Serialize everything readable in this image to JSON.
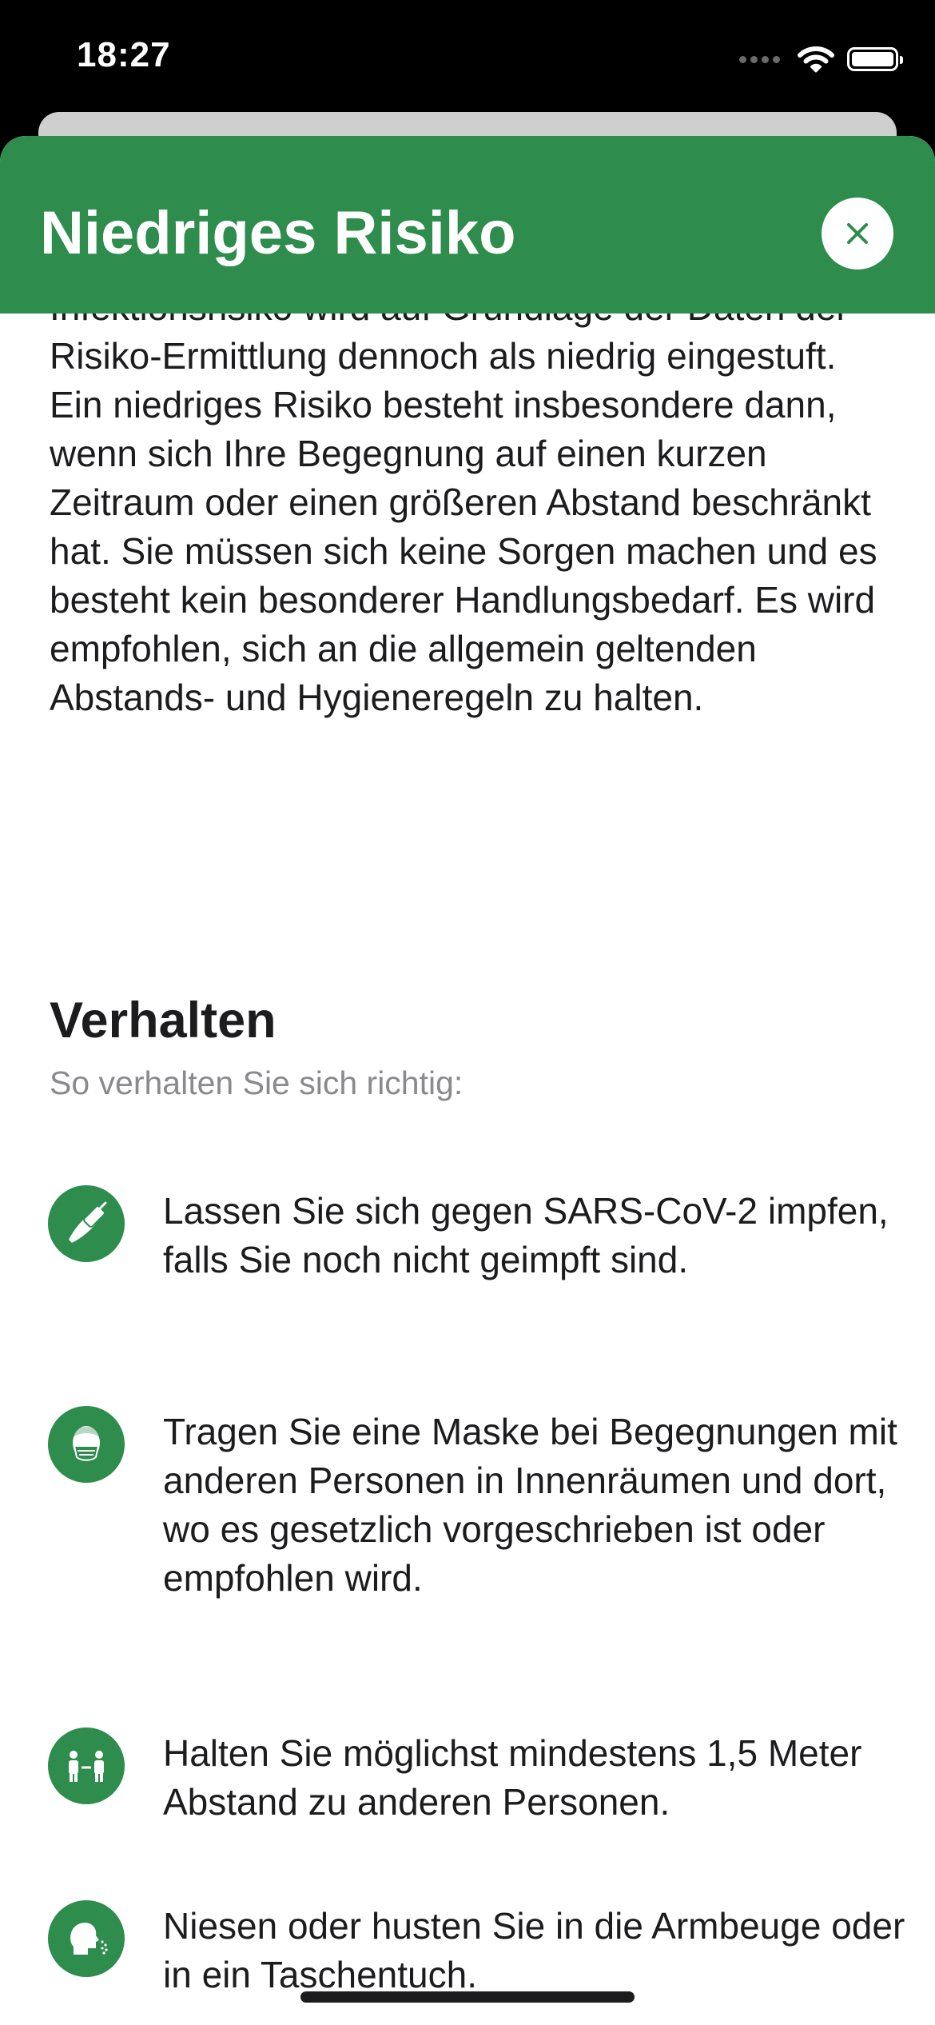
{
  "status_bar": {
    "time": "18:27"
  },
  "header": {
    "title": "Niedriges Risiko",
    "close_icon": "close-icon"
  },
  "description": "Infektionsrisiko wird auf Grundlage der Daten der Risiko-Ermittlung dennoch als niedrig eingestuft. Ein niedriges Risiko besteht insbesondere dann, wenn sich Ihre Begegnung auf einen kurzen Zeitraum oder einen größeren Abstand beschränkt hat. Sie müssen sich keine Sorgen machen und es besteht kein besonderer Handlungsbedarf. Es wird empfohlen, sich an die allgemein geltenden Abstands- und Hygieneregeln zu halten.",
  "behavior": {
    "title": "Verhalten",
    "subtitle": "So verhalten Sie sich richtig:",
    "items": [
      {
        "icon": "vaccine-arm-icon",
        "text": "Lassen Sie sich gegen SARS-CoV-2 impfen, falls Sie noch nicht geimpft sind."
      },
      {
        "icon": "face-mask-icon",
        "text": "Tragen Sie eine Maske bei Begegnungen mit anderen Personen in Innenräumen und dort, wo es gesetzlich vorgeschrieben ist oder empfohlen wird."
      },
      {
        "icon": "distance-icon",
        "text": "Halten Sie möglichst mindestens 1,5 Meter Abstand zu anderen Personen."
      },
      {
        "icon": "sneeze-icon",
        "text": "Niesen oder husten Sie in die Armbeuge oder in ein Taschentuch."
      }
    ]
  },
  "colors": {
    "accent": "#2e8c4d",
    "text": "#1c1c1e",
    "secondary_text": "#8a8a8e"
  }
}
